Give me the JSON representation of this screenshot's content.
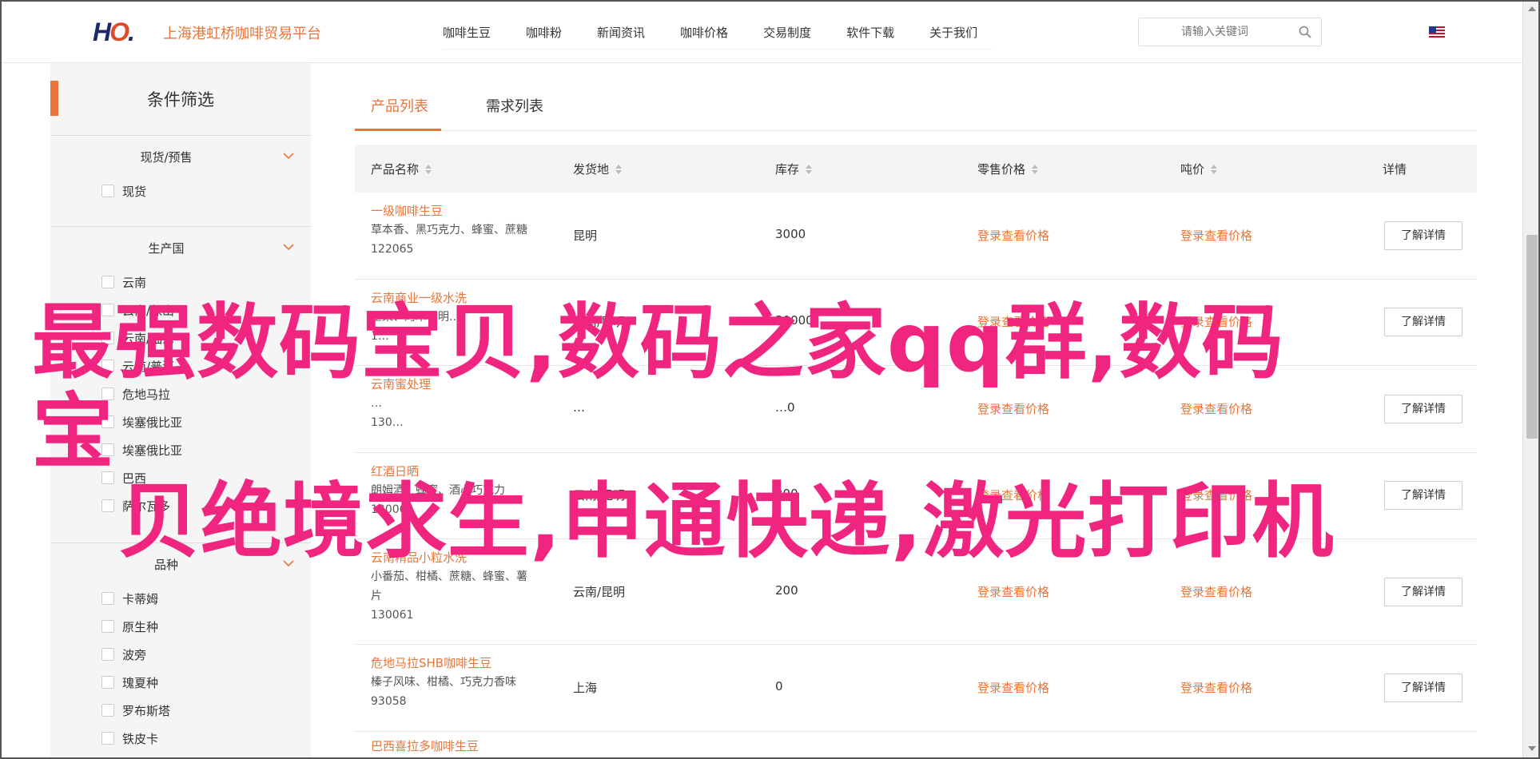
{
  "header": {
    "logo_text": "HO",
    "site_name": "上海港虹桥咖啡贸易平台",
    "nav": [
      "咖啡生豆",
      "咖啡粉",
      "新闻资讯",
      "咖啡价格",
      "交易制度",
      "软件下载",
      "关于我们"
    ],
    "search_placeholder": "请输入关键词",
    "search_icon": "search-icon",
    "flag_icon": "us-flag-icon"
  },
  "sidebar": {
    "title": "条件筛选",
    "sections": [
      {
        "title": "现货/预售",
        "options": [
          "现货"
        ]
      },
      {
        "title": "生产国",
        "options": [
          "云南",
          "云南/保山",
          "云南/临沧",
          "云南/普洱",
          "危地马拉",
          "埃塞俄比亚",
          "埃塞俄比亚",
          "巴西",
          "萨尔瓦多"
        ]
      },
      {
        "title": "品种",
        "options": [
          "卡蒂姆",
          "原生种",
          "波旁",
          "瑰夏种",
          "罗布斯塔",
          "铁皮卡"
        ]
      }
    ]
  },
  "main": {
    "tabs": [
      "产品列表",
      "需求列表"
    ],
    "columns": [
      "产品名称",
      "发货地",
      "库存",
      "零售价格",
      "吨价",
      "详情"
    ],
    "price_link": "登录查看价格",
    "detail_label": "了解详情",
    "rows": [
      {
        "name": "一级咖啡生豆",
        "desc": "草本香、黑巧克力、蜂蜜、蔗糖",
        "desc2": "",
        "id": "122065",
        "origin": "昆明",
        "stock": "3000"
      },
      {
        "name": "云南商业一级水洗",
        "desc": "坚果、烤木、明…",
        "desc2": "",
        "id": "1…",
        "origin": "云南/昆明",
        "stock": "30000"
      },
      {
        "name": "云南蜜处理",
        "desc": "…",
        "desc2": "",
        "id": "130…",
        "origin": "…",
        "stock": "…0"
      },
      {
        "name": "红酒日晒",
        "desc": "朗姆酒、蜂蜜、酒心巧克力",
        "desc2": "",
        "id": "130062",
        "origin": "云南/昆明",
        "stock": "200"
      },
      {
        "name": "云南精品小粒水洗",
        "desc": "小番茄、柑橘、蔗糖、蜂蜜、薯",
        "desc2": "片",
        "id": "130061",
        "origin": "云南/昆明",
        "stock": "200"
      },
      {
        "name": "危地马拉SHB咖啡生豆",
        "desc": "榛子风味、柑橘、巧克力香味",
        "desc2": "",
        "id": "93058",
        "origin": "上海",
        "stock": "0"
      },
      {
        "name": "巴西喜拉多咖啡生豆",
        "desc": "",
        "desc2": "",
        "id": "",
        "origin": "",
        "stock": ""
      }
    ]
  },
  "overlay": {
    "line1": "最强数码宝贝,数码之家qq群,数码宝",
    "line2": "贝绝境求生,申通快递,激光打印机"
  },
  "colors": {
    "accent": "#e8763a",
    "overlay": "#f0257f",
    "sidebar_bg": "#f5f5f5"
  }
}
